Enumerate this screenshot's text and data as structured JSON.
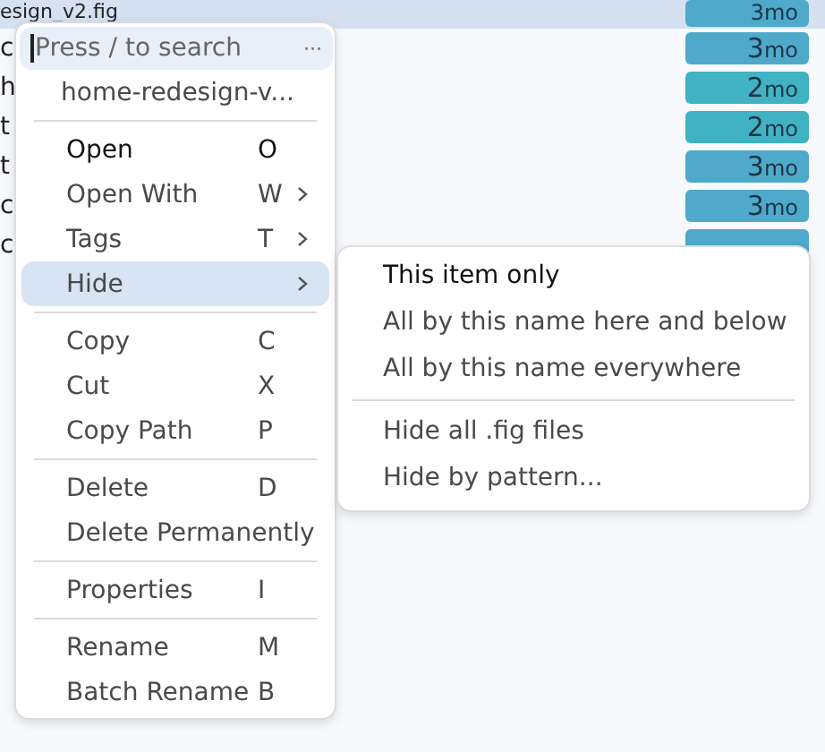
{
  "files": [
    {
      "name": "esign_v2.fig",
      "age_num": "3",
      "age_unit": "mo",
      "color": "#4ea9cb",
      "selected": true
    },
    {
      "name": "c",
      "age_num": "3",
      "age_unit": "mo",
      "color": "#4ea9cb",
      "selected": false
    },
    {
      "name": "h",
      "age_num": "2",
      "age_unit": "mo",
      "color": "#40b2c3",
      "selected": false
    },
    {
      "name": "t",
      "age_num": "2",
      "age_unit": "mo",
      "color": "#40b2c3",
      "selected": false
    },
    {
      "name": "t",
      "age_num": "3",
      "age_unit": "mo",
      "color": "#4ea9cb",
      "selected": false
    },
    {
      "name": "c",
      "age_num": "3",
      "age_unit": "mo",
      "color": "#4ea9cb",
      "selected": false
    },
    {
      "name": "c",
      "color": "#4ea9cb",
      "selected": false
    }
  ],
  "context_menu": {
    "search": {
      "placeholder": "Press / to search",
      "more": "···"
    },
    "title": "home-redesign-v...",
    "items": [
      {
        "kind": "divider"
      },
      {
        "kind": "item",
        "label": "Open",
        "shortcut": "O",
        "submenu": false,
        "default": true,
        "selected": false
      },
      {
        "kind": "item",
        "label": "Open With",
        "shortcut": "W",
        "submenu": true,
        "default": false,
        "selected": false
      },
      {
        "kind": "item",
        "label": "Tags",
        "shortcut": "T",
        "submenu": true,
        "default": false,
        "selected": false
      },
      {
        "kind": "item",
        "label": "Hide",
        "submenu": true,
        "default": false,
        "selected": true
      },
      {
        "kind": "divider"
      },
      {
        "kind": "item",
        "label": "Copy",
        "shortcut": "C",
        "submenu": false,
        "default": false,
        "selected": false
      },
      {
        "kind": "item",
        "label": "Cut",
        "shortcut": "X",
        "submenu": false,
        "default": false,
        "selected": false
      },
      {
        "kind": "item",
        "label": "Copy Path",
        "shortcut": "P",
        "submenu": false,
        "default": false,
        "selected": false
      },
      {
        "kind": "divider"
      },
      {
        "kind": "item",
        "label": "Delete",
        "shortcut": "D",
        "submenu": false,
        "default": false,
        "selected": false
      },
      {
        "kind": "item",
        "label": "Delete Permanently",
        "submenu": false,
        "default": false,
        "selected": false
      },
      {
        "kind": "divider"
      },
      {
        "kind": "item",
        "label": "Properties",
        "shortcut": "I",
        "submenu": false,
        "default": false,
        "selected": false
      },
      {
        "kind": "divider"
      },
      {
        "kind": "item",
        "label": "Rename",
        "shortcut": "M",
        "submenu": false,
        "default": false,
        "selected": false
      },
      {
        "kind": "item",
        "label": "Batch Rename",
        "shortcut": "B",
        "submenu": false,
        "default": false,
        "selected": false
      }
    ]
  },
  "submenu": {
    "items": [
      {
        "kind": "item",
        "label": "This item only",
        "default": true,
        "selected": false
      },
      {
        "kind": "item",
        "label": "All by this name here and below",
        "default": false,
        "selected": false
      },
      {
        "kind": "item",
        "label": "All by this name everywhere",
        "default": false,
        "selected": false
      },
      {
        "kind": "divider"
      },
      {
        "kind": "item",
        "label": "Hide all .fig files",
        "default": false,
        "selected": false
      },
      {
        "kind": "item",
        "label": "Hide by pattern...",
        "default": false,
        "selected": false
      }
    ]
  }
}
